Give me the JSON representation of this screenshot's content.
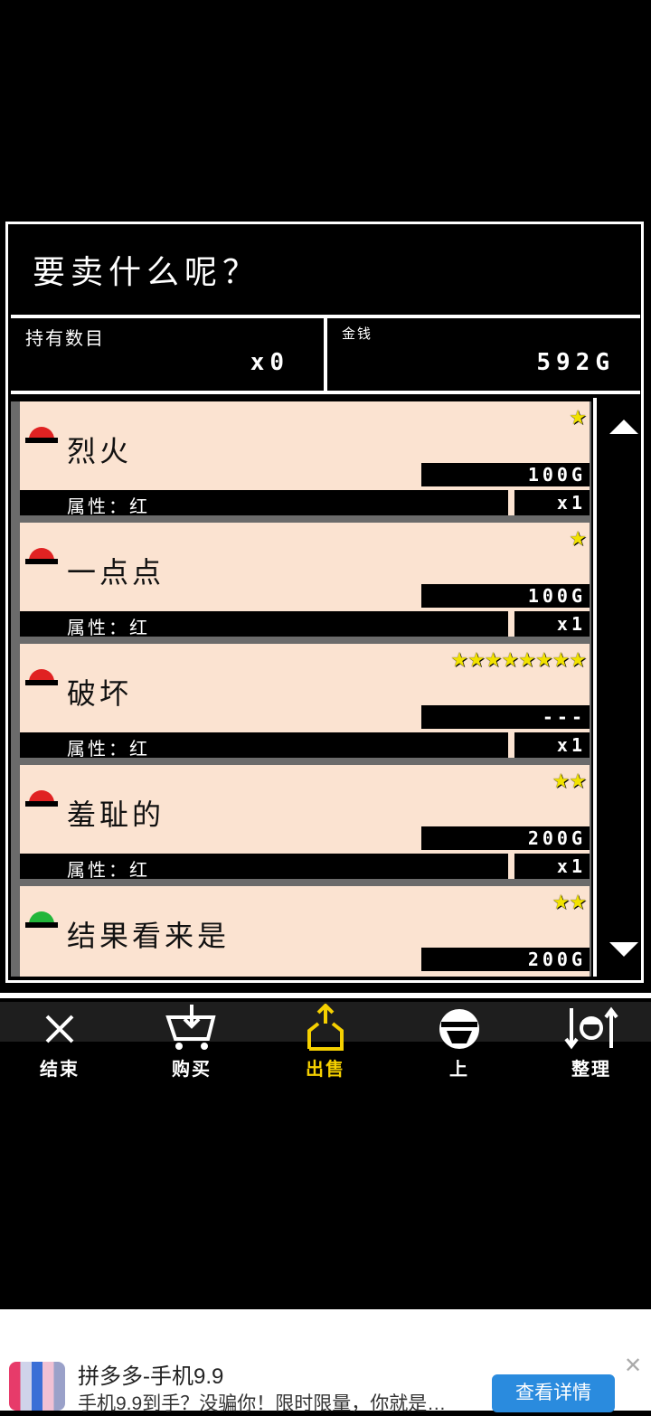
{
  "dialog": {
    "title": "要卖什么呢？",
    "held_label": "持有数目",
    "held_value": "x0",
    "money_label": "金钱",
    "money_value": "592G"
  },
  "items": [
    {
      "name": "烈火",
      "stars": "★",
      "price": "100G",
      "attr": "属性：红",
      "qty": "x1",
      "gem_color": "#e02222"
    },
    {
      "name": "一点点",
      "stars": "★",
      "price": "100G",
      "attr": "属性：红",
      "qty": "x1",
      "gem_color": "#e02222"
    },
    {
      "name": "破坏",
      "stars": "★★★★★★★★",
      "price": "---",
      "attr": "属性：红",
      "qty": "x1",
      "gem_color": "#e02222"
    },
    {
      "name": "羞耻的",
      "stars": "★★",
      "price": "200G",
      "attr": "属性：红",
      "qty": "x1",
      "gem_color": "#e02222"
    },
    {
      "name": "结果看来是",
      "stars": "★★",
      "price": "200G",
      "attr": "",
      "qty": "",
      "gem_color": "#22b63a"
    }
  ],
  "toolbar": [
    {
      "label": "结束",
      "icon": "close-icon",
      "color": "#ffffff"
    },
    {
      "label": "购买",
      "icon": "cart-icon",
      "color": "#ffffff"
    },
    {
      "label": "出售",
      "icon": "sell-icon",
      "color": "#f5d000"
    },
    {
      "label": "上",
      "icon": "gem-icon",
      "color": "#ffffff"
    },
    {
      "label": "整理",
      "icon": "sort-icon",
      "color": "#ffffff"
    }
  ],
  "ad": {
    "title": "拼多多-手机9.9",
    "text": "手机9.9到手？没骗你！限时限量，你就是…",
    "cta": "查看详情",
    "close": "✕"
  },
  "colors": {
    "card_bg": "#fbe3d1",
    "star": "#f2e200",
    "selected_tool": "#f5d000"
  }
}
